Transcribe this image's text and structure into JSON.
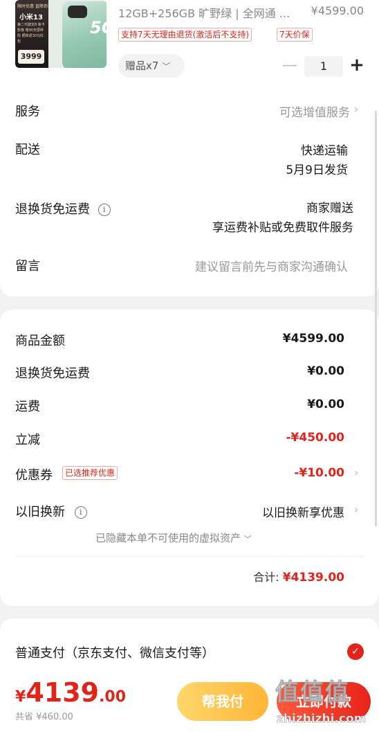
{
  "product": {
    "promo_box": {
      "banner": "限时优惠 直降到手",
      "model": "小米13",
      "features": "第二代骁龙8 徕卡影像 赠90天屏碎险 晒单返30元红包",
      "price": "3999"
    },
    "phone_badge": "5G",
    "spec": "12GB+256GB 旷野绿 | 全网通 ...",
    "price": "¥4599.00",
    "tags": [
      "支持7天无理由退货(激活后不支持)",
      "7天价保"
    ],
    "gifts_label": "赠品x7",
    "quantity": "1",
    "minus": "—",
    "plus": "+"
  },
  "order_options": {
    "service": {
      "label": "服务",
      "value": "可选增值服务"
    },
    "delivery": {
      "label": "配送",
      "method": "快递运输",
      "date": "5月9日发货"
    },
    "return_shipping": {
      "label": "退换货免运费",
      "provider": "商家赠送",
      "desc": "享运费补贴或免费取件服务"
    },
    "message": {
      "label": "留言",
      "placeholder": "建议留言前先与商家沟通确认"
    }
  },
  "summary": {
    "goods_amount": {
      "label": "商品金额",
      "value": "¥4599.00"
    },
    "return_fee": {
      "label": "退换货免运费",
      "value": "¥0.00"
    },
    "shipping": {
      "label": "运费",
      "value": "¥0.00"
    },
    "discount": {
      "label": "立减",
      "value": "-¥450.00"
    },
    "coupon": {
      "label": "优惠券",
      "tag": "已选推荐优惠",
      "value": "-¥10.00"
    },
    "trade_in": {
      "label": "以旧换新",
      "value": "以旧换新享优惠"
    },
    "hidden_assets": "已隐藏本单不可使用的虚拟资产",
    "total_label": "合计:",
    "total_value": "¥4139.00"
  },
  "payment": {
    "method": "普通支付（京东支付、微信支付等）"
  },
  "bottom": {
    "currency": "¥",
    "price_int": "4139",
    "price_dec": ".00",
    "saved": "共省 ¥460.00",
    "help_pay": "帮我付",
    "pay": "立即付款"
  },
  "watermark": {
    "logo": "值值值",
    "site": "zhizhizhi.com"
  },
  "colors": {
    "accent": "#e2231a",
    "help_button": "#ffc145",
    "background": "#f2f2f2"
  }
}
